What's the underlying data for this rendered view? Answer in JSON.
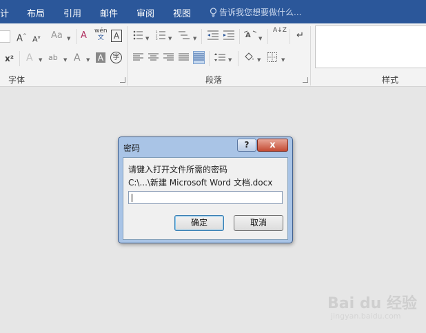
{
  "tabs": [
    "计",
    "布局",
    "引用",
    "邮件",
    "审阅",
    "视图"
  ],
  "tell_me": "告诉我您想要做什么...",
  "ribbon": {
    "groups": {
      "font": "字体",
      "paragraph": "段落",
      "styles": "样式"
    },
    "font_buttons": {
      "grow": "A",
      "shrink": "A",
      "case": "Aa",
      "clear": "A",
      "phonetic_top": "wén",
      "phonetic_bottom": "文",
      "border_char": "A",
      "superscript": "x²",
      "effects": "A",
      "highlight": "ab",
      "color": "A",
      "shading_char": "A",
      "enclose": "字"
    },
    "paragraph_buttons": {
      "sort": "A↓Z",
      "marks": "↵"
    }
  },
  "dialog": {
    "title": "密码",
    "help": "?",
    "close": "x",
    "prompt": "请键入打开文件所需的密码",
    "file_path": "C:\\...\\新建 Microsoft Word 文档.docx",
    "password_value": "",
    "ok": "确定",
    "cancel": "取消"
  },
  "watermark": {
    "brand": "Bai du 经验",
    "url": "jingyan.baidu.com"
  }
}
